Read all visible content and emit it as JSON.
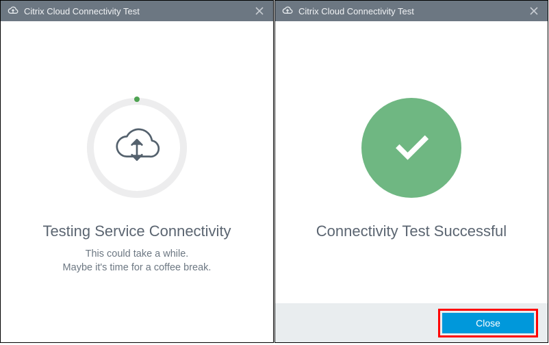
{
  "left": {
    "title": "Citrix Cloud Connectivity Test",
    "heading": "Testing Service Connectivity",
    "sub1": "This could take a while.",
    "sub2": "Maybe it's time for a coffee break.",
    "app_icon": "cloud-up-icon",
    "close_icon": "close-icon"
  },
  "right": {
    "title": "Citrix Cloud Connectivity Test",
    "heading": "Connectivity Test Successful",
    "close_label": "Close",
    "app_icon": "cloud-up-icon",
    "close_icon": "close-icon",
    "success_icon": "check-icon"
  },
  "colors": {
    "titlebar": "#6c7782",
    "accent": "#0098db",
    "success": "#6fb782",
    "highlight": "#ff0000",
    "text_heading": "#5b6571",
    "text_sub": "#6c7782"
  }
}
